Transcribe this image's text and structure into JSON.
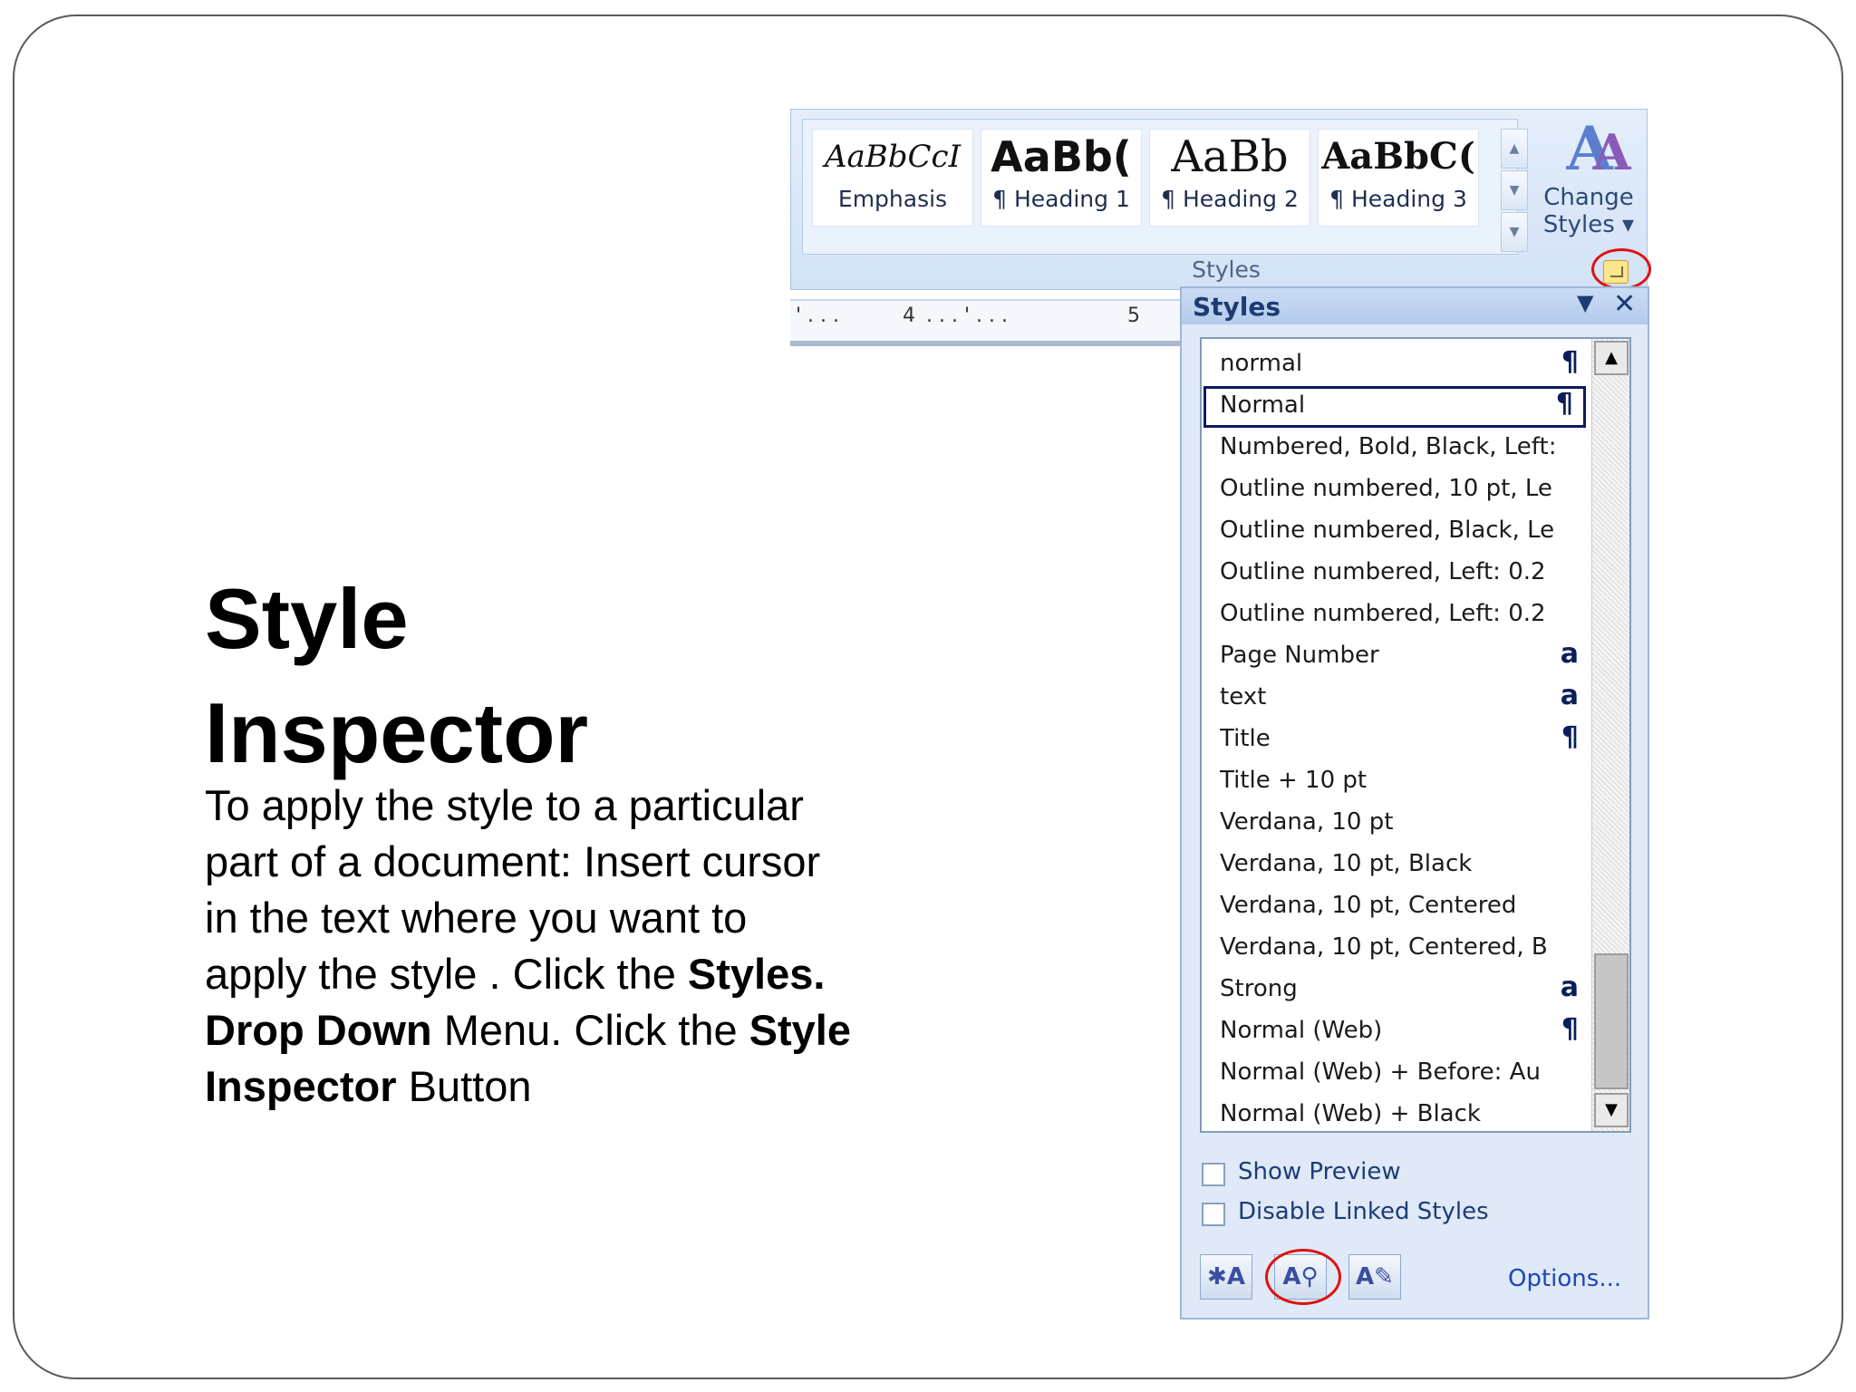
{
  "slide": {
    "title_line1": "Style",
    "title_line2": "Inspector",
    "body": {
      "p1": "To apply the style to a particular part of a document: Insert cursor in the text where you want to apply the style . Click the ",
      "b1": "Styles. Drop Down",
      "p2": " Menu. Click the ",
      "b2": "Style Inspector",
      "p3": " Button"
    }
  },
  "ribbon": {
    "gallery": [
      {
        "sample": "AaBbCcI",
        "name": "Emphasis"
      },
      {
        "sample": "AaBb(",
        "name": "¶ Heading 1"
      },
      {
        "sample": "AaBb",
        "name": "¶ Heading 2"
      },
      {
        "sample": "AaBbC(",
        "name": "¶ Heading 3"
      }
    ],
    "change_styles_line1": "Change",
    "change_styles_line2": "Styles ▾",
    "group_label": "Styles"
  },
  "ruler": {
    "tick_4": "4",
    "tick_5": "5"
  },
  "styles_pane": {
    "title": "Styles",
    "items": [
      {
        "label": "normal",
        "mark": "¶"
      },
      {
        "label": "Normal",
        "mark": "¶"
      },
      {
        "label": "Numbered, Bold, Black, Left:",
        "mark": ""
      },
      {
        "label": "Outline numbered, 10 pt, Le",
        "mark": ""
      },
      {
        "label": "Outline numbered, Black, Lei",
        "mark": ""
      },
      {
        "label": "Outline numbered, Left:  0.2",
        "mark": ""
      },
      {
        "label": "Outline numbered, Left:  0.2",
        "mark": ""
      },
      {
        "label": "Page Number",
        "mark": "a"
      },
      {
        "label": "text",
        "mark": "a"
      },
      {
        "label": "Title",
        "mark": "¶"
      },
      {
        "label": "Title + 10 pt",
        "mark": ""
      },
      {
        "label": "Verdana, 10 pt",
        "mark": ""
      },
      {
        "label": "Verdana, 10 pt, Black",
        "mark": ""
      },
      {
        "label": "Verdana, 10 pt, Centered",
        "mark": ""
      },
      {
        "label": "Verdana, 10 pt, Centered, B",
        "mark": ""
      },
      {
        "label": "Strong",
        "mark": "a"
      },
      {
        "label": "Normal (Web)",
        "mark": "¶"
      },
      {
        "label": "Normal (Web) + Before:  Au",
        "mark": ""
      },
      {
        "label": "Normal (Web) + Black",
        "mark": ""
      }
    ],
    "show_preview": "Show Preview",
    "disable_linked": "Disable Linked Styles",
    "options": "Options..."
  },
  "colors": {
    "accent_red": "#e01010",
    "pane_blue": "#dfe9f7"
  }
}
